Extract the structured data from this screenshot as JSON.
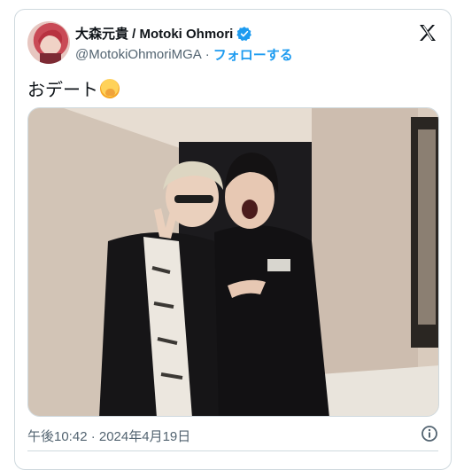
{
  "user": {
    "display_name": "大森元貴 / Motoki Ohmori",
    "handle": "@MotokiOhmoriMGA",
    "separator": "·",
    "follow_label": "フォローする",
    "verified_icon": "verified-badge-icon"
  },
  "tweet": {
    "text": "おデート",
    "emoji": "face-with-hand-over-mouth"
  },
  "footer": {
    "timestamp": "午後10:42 · 2024年4月19日",
    "info_icon": "info-icon"
  },
  "colors": {
    "accent": "#1d9bf0",
    "text": "#0f1419",
    "secondary": "#536471",
    "border": "#cfd9de"
  }
}
